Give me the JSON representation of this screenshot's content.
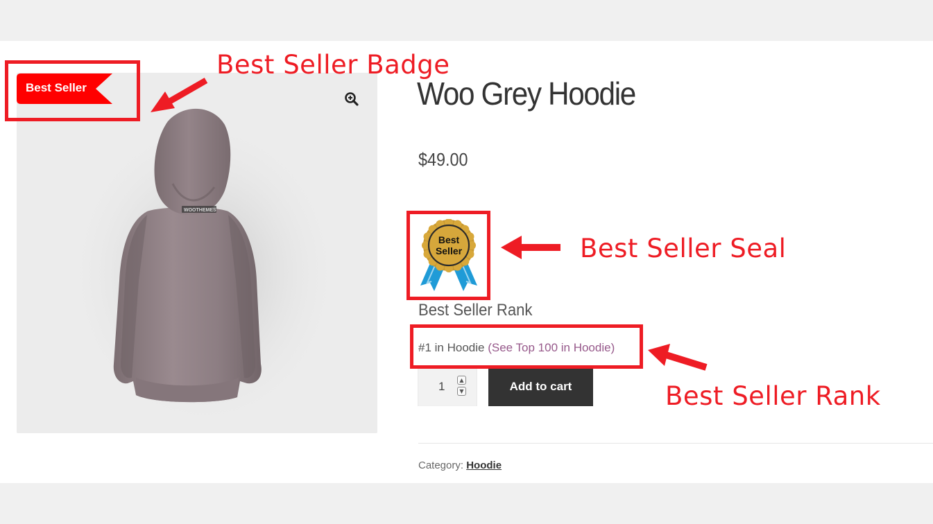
{
  "product": {
    "title": "Woo Grey Hoodie",
    "price": "$49.00",
    "badge_label": "Best Seller",
    "seal_text_line1": "Best",
    "seal_text_line2": "Seller",
    "rank_heading": "Best Seller Rank",
    "rank_text": "#1 in Hoodie",
    "rank_link": "(See Top 100 in Hoodie)",
    "quantity": "1",
    "add_to_cart_label": "Add to cart",
    "category_label": "Category:",
    "category_value": "Hoodie",
    "image_logo_text": "WOOTHEMES"
  },
  "annotations": {
    "badge_label": "Best Seller Badge",
    "seal_label": "Best Seller Seal",
    "rank_label": "Best Seller Rank",
    "color": "#ee1c24"
  },
  "colors": {
    "badge_red": "#ff0000",
    "button_dark": "#333333",
    "link_purple": "#96588a",
    "seal_gold": "#d4a437",
    "ribbon_blue": "#1f9bd7"
  },
  "icons": {
    "zoom": "magnifier-plus-icon"
  }
}
